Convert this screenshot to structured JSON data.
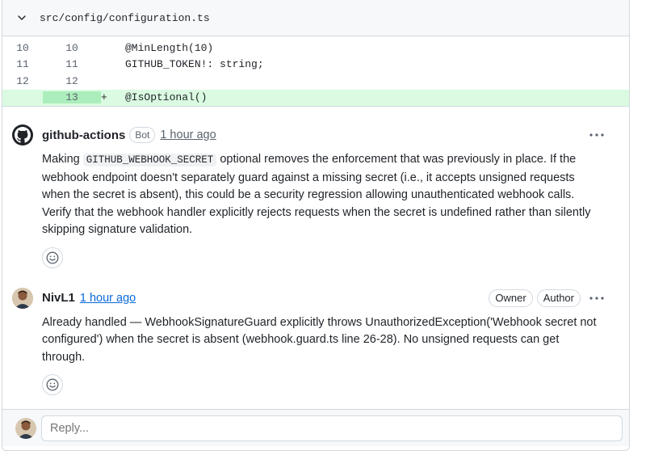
{
  "file": {
    "path": "src/config/configuration.ts"
  },
  "diff_lines": [
    {
      "old": "10",
      "new": "10",
      "sign": "",
      "code": "@MinLength(10)"
    },
    {
      "old": "11",
      "new": "11",
      "sign": "",
      "code": "GITHUB_TOKEN!: string;"
    },
    {
      "old": "12",
      "new": "12",
      "sign": "",
      "code": ""
    },
    {
      "old": "",
      "new": "13",
      "sign": "+",
      "code": "@IsOptional()"
    }
  ],
  "comments": [
    {
      "author": "github-actions",
      "badge": "Bot",
      "time": "1 hour ago",
      "body_pre": "Making ",
      "body_code": "GITHUB_WEBHOOK_SECRET",
      "body_post": " optional removes the enforcement that was previously in place. If the webhook endpoint doesn't separately guard against a missing secret (i.e., it accepts unsigned requests when the secret is absent), this could be a security regression allowing unauthenticated webhook calls. Verify that the webhook handler explicitly rejects requests when the secret is undefined rather than silently skipping signature validation."
    },
    {
      "author": "NivL1",
      "time": "1 hour ago",
      "badges": [
        "Owner",
        "Author"
      ],
      "body": "Already handled — WebhookSignatureGuard explicitly throws UnauthorizedException('Webhook secret not configured') when the secret is absent (webhook.guard.ts line 26-28). No unsigned requests can get through."
    }
  ],
  "reply": {
    "placeholder": "Reply..."
  },
  "colors": {
    "added_bg": "#dafbe1",
    "added_gutter": "#aceebb",
    "link": "#0969da",
    "muted": "#59636e"
  }
}
